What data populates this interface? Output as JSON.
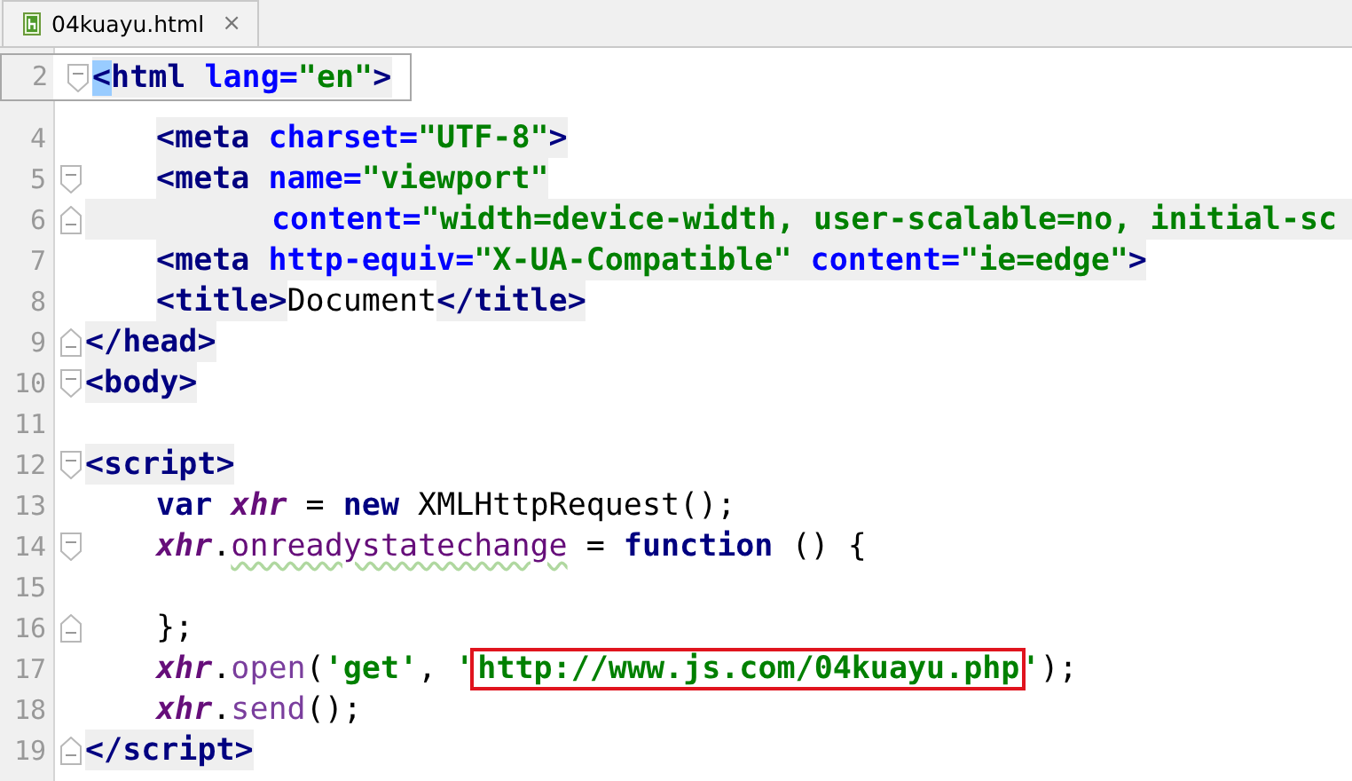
{
  "tab": {
    "label": "04kuayu.html",
    "close": "×"
  },
  "sticky_line": {
    "number": "2",
    "fold": {
      "kind": "start"
    },
    "parts": [
      {
        "shaded": true,
        "tokens": [
          {
            "text": "<",
            "kind": "tag-match"
          },
          {
            "text": "html ",
            "kind": "tag"
          },
          {
            "text": "lang=",
            "kind": "attr"
          },
          {
            "text": "\"en\"",
            "kind": "string"
          },
          {
            "text": ">",
            "kind": "tag"
          }
        ]
      }
    ]
  },
  "lines": [
    {
      "number": "4",
      "indent": {
        "kind": "single"
      },
      "shade_to_edge": false,
      "parts": [
        {
          "shaded": true,
          "tokens": [
            {
              "text": "<meta ",
              "kind": "tag"
            },
            {
              "text": "charset=",
              "kind": "attr"
            },
            {
              "text": "\"UTF-8\"",
              "kind": "string"
            },
            {
              "text": ">",
              "kind": "tag"
            }
          ]
        }
      ]
    },
    {
      "number": "5",
      "fold": {
        "kind": "start"
      },
      "indent": {
        "kind": "single"
      },
      "shade_to_edge": false,
      "parts": [
        {
          "shaded": true,
          "tokens": [
            {
              "text": "<meta ",
              "kind": "tag"
            },
            {
              "text": "name=",
              "kind": "attr"
            },
            {
              "text": "\"viewport\"",
              "kind": "string"
            }
          ]
        }
      ]
    },
    {
      "number": "6",
      "fold": {
        "kind": "end"
      },
      "indent": {
        "kind": "double"
      },
      "shade_to_edge": true,
      "parts": [
        {
          "shaded": true,
          "tokens": [
            {
              "text": "content=",
              "kind": "attr"
            },
            {
              "text": "\"width=device-width, user-scalable=no, initial-sc",
              "kind": "string"
            }
          ]
        }
      ]
    },
    {
      "number": "7",
      "indent": {
        "kind": "single"
      },
      "shade_to_edge": false,
      "parts": [
        {
          "shaded": true,
          "tokens": [
            {
              "text": "<meta ",
              "kind": "tag"
            },
            {
              "text": "http-equiv=",
              "kind": "attr"
            },
            {
              "text": "\"X-UA-Compatible\" ",
              "kind": "string"
            },
            {
              "text": "content=",
              "kind": "attr"
            },
            {
              "text": "\"ie=edge\"",
              "kind": "string"
            },
            {
              "text": ">",
              "kind": "tag"
            }
          ]
        }
      ]
    },
    {
      "number": "8",
      "indent": {
        "kind": "single"
      },
      "shade_to_edge": false,
      "parts": [
        {
          "shaded": true,
          "tokens": [
            {
              "text": "<title>",
              "kind": "tag"
            }
          ]
        },
        {
          "shaded": false,
          "tokens": [
            {
              "text": "Document",
              "kind": "text"
            }
          ]
        },
        {
          "shaded": true,
          "tokens": [
            {
              "text": "</title>",
              "kind": "tag"
            }
          ]
        }
      ]
    },
    {
      "number": "9",
      "fold": {
        "kind": "end"
      },
      "shade_to_edge": false,
      "parts": [
        {
          "shaded": true,
          "tokens": [
            {
              "text": "</head>",
              "kind": "tag"
            }
          ]
        }
      ]
    },
    {
      "number": "10",
      "fold": {
        "kind": "start"
      },
      "shade_to_edge": false,
      "parts": [
        {
          "shaded": true,
          "tokens": [
            {
              "text": "<body>",
              "kind": "tag"
            }
          ]
        }
      ]
    },
    {
      "number": "11",
      "shade_to_edge": false
    },
    {
      "number": "12",
      "fold": {
        "kind": "start"
      },
      "shade_to_edge": false,
      "parts": [
        {
          "shaded": true,
          "tokens": [
            {
              "text": "<script>",
              "kind": "tag"
            }
          ]
        }
      ]
    },
    {
      "number": "13",
      "indent": {
        "kind": "single"
      },
      "shade_to_edge": false,
      "parts": [
        {
          "shaded": false,
          "tokens": [
            {
              "text": "var ",
              "kind": "keyword"
            },
            {
              "text": "xhr",
              "kind": "var"
            },
            {
              "text": " = ",
              "kind": "text"
            },
            {
              "text": "new ",
              "kind": "keyword"
            },
            {
              "text": "XMLHttpRequest();",
              "kind": "text"
            }
          ]
        }
      ]
    },
    {
      "number": "14",
      "fold": {
        "kind": "start"
      },
      "indent": {
        "kind": "single"
      },
      "shade_to_edge": false,
      "parts": [
        {
          "shaded": false,
          "tokens": [
            {
              "text": "xhr",
              "kind": "var"
            },
            {
              "text": ".",
              "kind": "text"
            },
            {
              "text": "onreadystatechange",
              "kind": "field-squiggle"
            },
            {
              "text": " = ",
              "kind": "text"
            },
            {
              "text": "function ",
              "kind": "keyword"
            },
            {
              "text": "() {",
              "kind": "text"
            }
          ]
        }
      ]
    },
    {
      "number": "15",
      "shade_to_edge": false
    },
    {
      "number": "16",
      "fold": {
        "kind": "end"
      },
      "indent": {
        "kind": "single"
      },
      "shade_to_edge": false,
      "parts": [
        {
          "shaded": false,
          "tokens": [
            {
              "text": "};",
              "kind": "text"
            }
          ]
        }
      ]
    },
    {
      "number": "17",
      "indent": {
        "kind": "single"
      },
      "shade_to_edge": false,
      "parts": [
        {
          "shaded": false,
          "tokens": [
            {
              "text": "xhr",
              "kind": "var"
            },
            {
              "text": ".",
              "kind": "text"
            },
            {
              "text": "open",
              "kind": "method"
            },
            {
              "text": "(",
              "kind": "text"
            },
            {
              "text": "'get'",
              "kind": "string"
            },
            {
              "text": ", ",
              "kind": "text"
            },
            {
              "text": "'",
              "kind": "string"
            },
            {
              "text": "http://www.js.com/04kuayu.php",
              "kind": "string-boxed"
            },
            {
              "text": "'",
              "kind": "string"
            },
            {
              "text": ");",
              "kind": "text"
            }
          ]
        }
      ]
    },
    {
      "number": "18",
      "indent": {
        "kind": "single"
      },
      "shade_to_edge": false,
      "parts": [
        {
          "shaded": false,
          "tokens": [
            {
              "text": "xhr",
              "kind": "var"
            },
            {
              "text": ".",
              "kind": "text"
            },
            {
              "text": "send",
              "kind": "method"
            },
            {
              "text": "();",
              "kind": "text"
            }
          ]
        }
      ]
    },
    {
      "number": "19",
      "fold": {
        "kind": "end"
      },
      "shade_to_edge": false,
      "parts": [
        {
          "shaded": true,
          "tokens": [
            {
              "text": "</script>",
              "kind": "tag"
            }
          ]
        }
      ]
    }
  ]
}
